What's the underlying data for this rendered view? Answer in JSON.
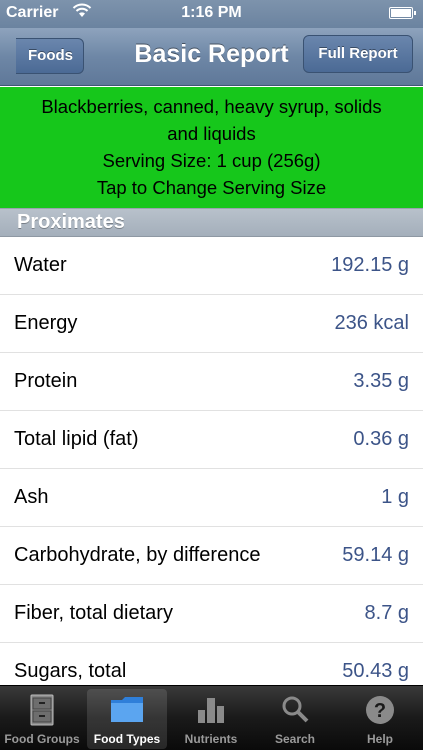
{
  "status": {
    "carrier": "Carrier",
    "time": "1:16 PM"
  },
  "nav": {
    "back_label": "Foods",
    "title": "Basic Report",
    "full_report_label": "Full Report"
  },
  "food": {
    "name_line1": "Blackberries, canned, heavy syrup, solids",
    "name_line2": "and liquids",
    "serving": "Serving Size: 1 cup (256g)",
    "hint": "Tap to Change Serving Size"
  },
  "section": {
    "title": "Proximates"
  },
  "rows": [
    {
      "label": "Water",
      "value": "192.15 g"
    },
    {
      "label": "Energy",
      "value": "236 kcal"
    },
    {
      "label": "Protein",
      "value": "3.35 g"
    },
    {
      "label": "Total lipid (fat)",
      "value": "0.36 g"
    },
    {
      "label": "Ash",
      "value": "1 g"
    },
    {
      "label": "Carbohydrate, by difference",
      "value": "59.14 g"
    },
    {
      "label": "Fiber, total dietary",
      "value": "8.7 g"
    },
    {
      "label": "Sugars, total",
      "value": "50.43 g"
    }
  ],
  "tabs": [
    {
      "label": "Food Groups",
      "icon": "cabinet-icon"
    },
    {
      "label": "Food Types",
      "icon": "folder-icon"
    },
    {
      "label": "Nutrients",
      "icon": "bar-chart-icon"
    },
    {
      "label": "Search",
      "icon": "search-icon"
    },
    {
      "label": "Help",
      "icon": "help-icon"
    }
  ],
  "active_tab": "Food Types",
  "colors": {
    "header_green": "#16c71b",
    "value_blue": "#3c5488",
    "nav_blue": "#6e87a6"
  }
}
